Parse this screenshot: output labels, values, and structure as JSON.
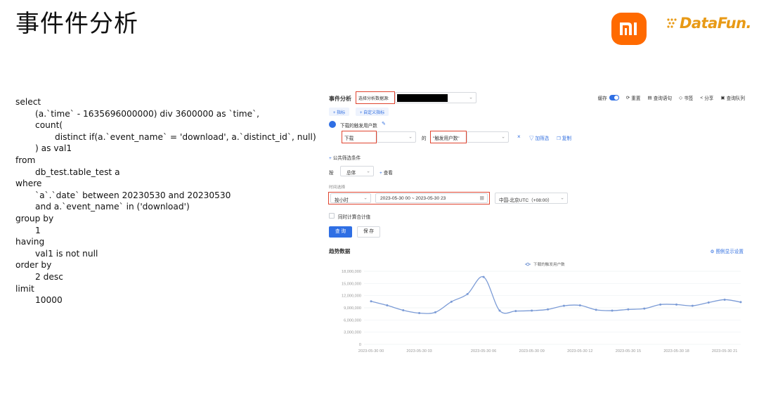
{
  "slide": {
    "title": "事件件分析",
    "logo_mi": "mi",
    "logo_datafun": "DataFun."
  },
  "sql": [
    {
      "text": "select",
      "indent": 0
    },
    {
      "text": "(a.`time` - 1635696000000) div 3600000 as `time`,",
      "indent": 1
    },
    {
      "text": "count(",
      "indent": 1
    },
    {
      "text": "distinct if(a.`event_name` = 'download', a.`distinct_id`, null)",
      "indent": 2
    },
    {
      "text": ") as val1",
      "indent": 1
    },
    {
      "text": "from",
      "indent": 0
    },
    {
      "text": "db_test.table_test a",
      "indent": 1
    },
    {
      "text": "where",
      "indent": 0
    },
    {
      "text": "`a`.`date` between 20230530 and 20230530",
      "indent": 1
    },
    {
      "text": "and a.`event_name` in ('download')",
      "indent": 1
    },
    {
      "text": "group by",
      "indent": 0
    },
    {
      "text": "1",
      "indent": 1
    },
    {
      "text": "having",
      "indent": 0
    },
    {
      "text": "val1 is not null",
      "indent": 1
    },
    {
      "text": "order by",
      "indent": 0
    },
    {
      "text": "2 desc",
      "indent": 1
    },
    {
      "text": "limit",
      "indent": 0
    },
    {
      "text": "10000",
      "indent": 1
    }
  ],
  "app": {
    "title": "事件分析",
    "datasource_label": "选择分析数据源:",
    "toolbar": {
      "cache_label": "缓存",
      "reset": "重置",
      "query_sql": "查询语句",
      "bookmark": "书签",
      "share": "分享",
      "query_queue": "查询队列"
    },
    "add_metric": "+ 指标",
    "add_custom_metric": "+ 自定义指标",
    "metric_name": "下载的触发用户数",
    "event_value": "下载",
    "of_label": "的",
    "measure_value": "\"触发用户数\"",
    "add_filter": "加筛选",
    "copy": "复制",
    "public_filter": "公共筛选条件",
    "by_label": "按",
    "group_value": "总体",
    "view_label": "查看",
    "time_select_label": "时间选择",
    "granularity_value": "按小时",
    "date_range": "2023-05-30 00 ~ 2023-05-30 23",
    "timezone_value": "中国-北京UTC（+08:00）",
    "sum_checkbox_label": "同时计算合计值",
    "query_button": "查 询",
    "save_button": "保 存",
    "trend_title": "趋势数据",
    "legend_settings": "图例显示设置"
  },
  "chart_data": {
    "type": "line",
    "x": [
      "2023-05-30 00",
      "2023-05-30 01",
      "2023-05-30 02",
      "2023-05-30 03",
      "2023-05-30 04",
      "2023-05-30 05",
      "2023-05-30 06",
      "2023-05-30 07",
      "2023-05-30 08",
      "2023-05-30 09",
      "2023-05-30 10",
      "2023-05-30 11",
      "2023-05-30 12",
      "2023-05-30 13",
      "2023-05-30 14",
      "2023-05-30 15",
      "2023-05-30 16",
      "2023-05-30 17",
      "2023-05-30 18",
      "2023-05-30 19",
      "2023-05-30 20",
      "2023-05-30 21",
      "2023-05-30 22",
      "2023-05-30 23"
    ],
    "series": [
      {
        "name": "下载的触发用户数",
        "values": [
          10600000,
          9600000,
          8400000,
          7700000,
          7900000,
          10500000,
          12400000,
          16600000,
          8300000,
          8200000,
          8300000,
          8600000,
          9500000,
          9600000,
          8500000,
          8300000,
          8600000,
          8800000,
          9800000,
          9800000,
          9500000,
          10300000,
          11000000,
          10400000
        ]
      }
    ],
    "x_tick_labels": [
      "2023-05-30 00",
      "2023-05-30 03",
      "2023-05-30 06",
      "2023-05-30 09",
      "2023-05-30 12",
      "2023-05-30 15",
      "2023-05-30 18",
      "2023-05-30 21"
    ],
    "x_tick_indices": [
      0,
      3,
      7,
      10,
      13,
      16,
      19,
      22
    ],
    "y_ticks": [
      0,
      3000000,
      6000000,
      9000000,
      12000000,
      15000000,
      18000000
    ],
    "y_tick_labels": [
      "0",
      "3,000,000",
      "6,000,000",
      "9,000,000",
      "12,000,000",
      "15,000,000",
      "18,000,000"
    ],
    "ylim": [
      0,
      18000000
    ],
    "legend_placement": "top-center",
    "grid": true,
    "line_color": "#7b9bd6"
  }
}
